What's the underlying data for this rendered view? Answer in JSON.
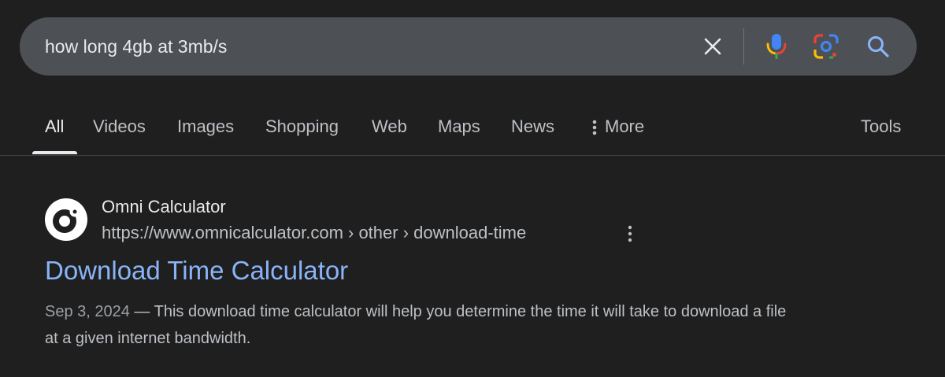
{
  "search": {
    "query": "how long 4gb at 3mb/s",
    "clear_icon": "close-icon",
    "mic_icon": "microphone-icon",
    "lens_icon": "google-lens-icon",
    "search_icon": "search-icon"
  },
  "tabs": [
    {
      "label": "All",
      "active": true
    },
    {
      "label": "Videos"
    },
    {
      "label": "Images"
    },
    {
      "label": "Shopping"
    },
    {
      "label": "Web"
    },
    {
      "label": "Maps"
    },
    {
      "label": "News"
    },
    {
      "label": "More",
      "icon": "vertical-dots-icon"
    }
  ],
  "tools_label": "Tools",
  "result": {
    "site_name": "Omni Calculator",
    "url": "https://www.omnicalculator.com › other › download-time",
    "title": "Download Time Calculator",
    "date": "Sep 3, 2024",
    "separator": " — ",
    "snippet": "This download time calculator will help you determine the time it will take to download a file at a given internet bandwidth."
  },
  "colors": {
    "background": "#1f1f1f",
    "search_bar": "#4d5156",
    "link": "#8ab4f8",
    "text": "#e8eaed",
    "muted": "#bdc1c6"
  }
}
